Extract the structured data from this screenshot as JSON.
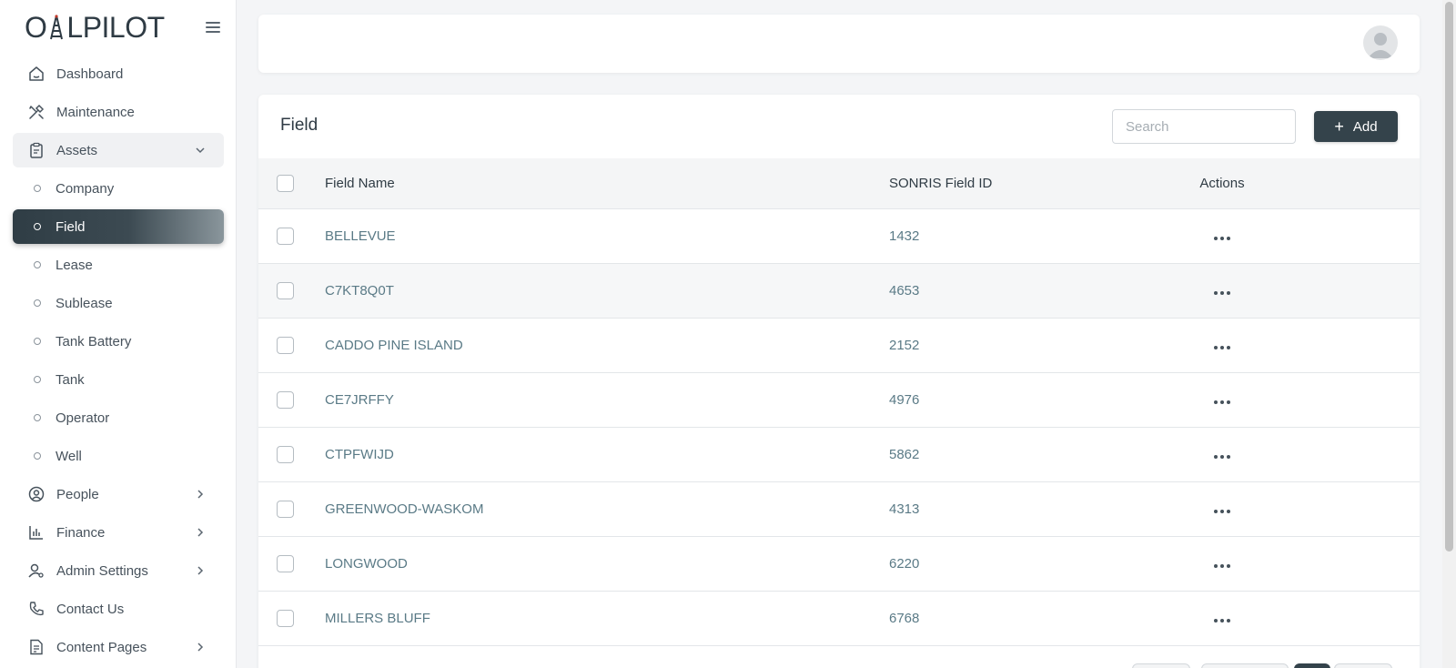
{
  "app": {
    "logo_text_1": "O",
    "logo_text_2": "LPILOT"
  },
  "sidebar": {
    "items": [
      {
        "label": "Dashboard",
        "icon": "home-icon"
      },
      {
        "label": "Maintenance",
        "icon": "tools-icon"
      },
      {
        "label": "Assets",
        "icon": "clipboard-icon",
        "expanded": true
      },
      {
        "label": "Company",
        "sub": true
      },
      {
        "label": "Field",
        "sub": true,
        "active": true
      },
      {
        "label": "Lease",
        "sub": true
      },
      {
        "label": "Sublease",
        "sub": true
      },
      {
        "label": "Tank Battery",
        "sub": true
      },
      {
        "label": "Tank",
        "sub": true
      },
      {
        "label": "Operator",
        "sub": true
      },
      {
        "label": "Well",
        "sub": true
      },
      {
        "label": "People",
        "icon": "user-circle-icon",
        "chevron": "right"
      },
      {
        "label": "Finance",
        "icon": "bar-chart-icon",
        "chevron": "right"
      },
      {
        "label": "Admin Settings",
        "icon": "user-gear-icon",
        "chevron": "right"
      },
      {
        "label": "Contact Us",
        "icon": "phone-icon"
      },
      {
        "label": "Content Pages",
        "icon": "document-icon",
        "chevron": "right"
      }
    ]
  },
  "main": {
    "title": "Field",
    "search_placeholder": "Search",
    "add_label": "Add",
    "columns": [
      "Field Name",
      "SONRIS Field ID",
      "Actions"
    ],
    "rows": [
      {
        "name": "BELLEVUE",
        "id": "1432"
      },
      {
        "name": "C7KT8Q0T",
        "id": "4653"
      },
      {
        "name": "CADDO PINE ISLAND",
        "id": "2152"
      },
      {
        "name": "CE7JRFFY",
        "id": "4976"
      },
      {
        "name": "CTPFWIJD",
        "id": "5862"
      },
      {
        "name": "GREENWOOD-WASKOM",
        "id": "4313"
      },
      {
        "name": "LONGWOOD",
        "id": "6220"
      },
      {
        "name": "MILLERS BLUFF",
        "id": "6768"
      }
    ]
  },
  "colors": {
    "accent": "#34434b",
    "link": "#5a7a86"
  }
}
